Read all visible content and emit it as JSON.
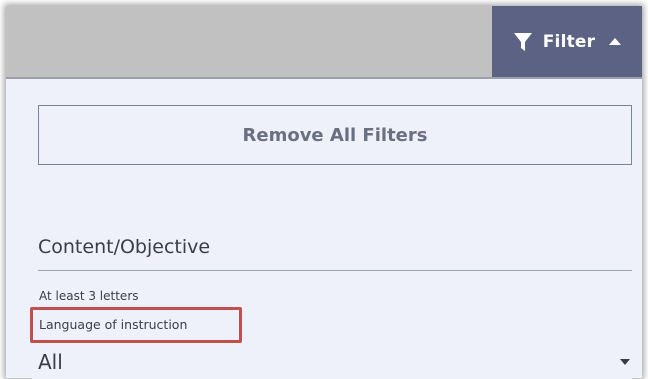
{
  "header": {
    "filter_label": "Filter"
  },
  "panel": {
    "remove_all_label": "Remove All Filters",
    "content_objective": {
      "placeholder": "Content/Objective",
      "value": "",
      "helper": "At least 3 letters"
    },
    "language": {
      "label": "Language of instruction",
      "selected": "All"
    }
  },
  "colors": {
    "topbar": "#c1c1c1",
    "filter_button": "#5b6283",
    "panel_bg": "#eef1fa",
    "highlight": "#c0504d"
  },
  "icons": {
    "filter": "funnel-icon",
    "filter_toggle": "caret-up-icon",
    "select": "caret-down-icon"
  }
}
